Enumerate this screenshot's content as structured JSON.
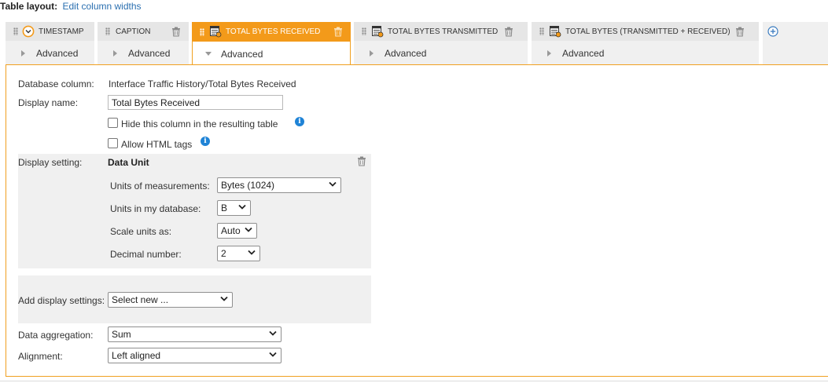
{
  "header": {
    "label": "Table layout:",
    "link": "Edit column widths"
  },
  "tabs": [
    {
      "label": "TIMESTAMP",
      "sub": "Advanced",
      "icon": "clock-icon",
      "active": false
    },
    {
      "label": "CAPTION",
      "sub": "Advanced",
      "icon": "",
      "active": false
    },
    {
      "label": "TOTAL BYTES RECEIVED",
      "sub": "Advanced",
      "icon": "table-column-icon",
      "active": true
    },
    {
      "label": "TOTAL BYTES TRANSMITTED",
      "sub": "Advanced",
      "icon": "table-column-icon",
      "active": false
    },
    {
      "label": "TOTAL BYTES (TRANSMITTED + RECEIVED)",
      "sub": "Advanced",
      "icon": "table-column-icon",
      "active": false
    }
  ],
  "form": {
    "db_column_label": "Database column:",
    "db_column_value": "Interface Traffic History/Total Bytes Received",
    "display_name_label": "Display name:",
    "display_name_value": "Total Bytes Received",
    "hide_column_label": "Hide this column in the resulting table",
    "hide_column_checked": false,
    "allow_html_label": "Allow HTML tags",
    "allow_html_checked": false,
    "display_setting_label": "Display setting:",
    "data_unit": {
      "title": "Data Unit",
      "units_measure_label": "Units of measurements:",
      "units_measure_value": "Bytes (1024)",
      "units_db_label": "Units in my database:",
      "units_db_value": "B",
      "scale_label": "Scale units as:",
      "scale_value": "Auto",
      "decimal_label": "Decimal number:",
      "decimal_value": "2"
    },
    "add_display_label": "Add display settings:",
    "add_display_value": "Select new ...",
    "aggregation_label": "Data aggregation:",
    "aggregation_value": "Sum",
    "alignment_label": "Alignment:",
    "alignment_value": "Left aligned"
  },
  "colors": {
    "accent": "#f39a1a",
    "link": "#2a6fb0",
    "info": "#1f83d6"
  }
}
